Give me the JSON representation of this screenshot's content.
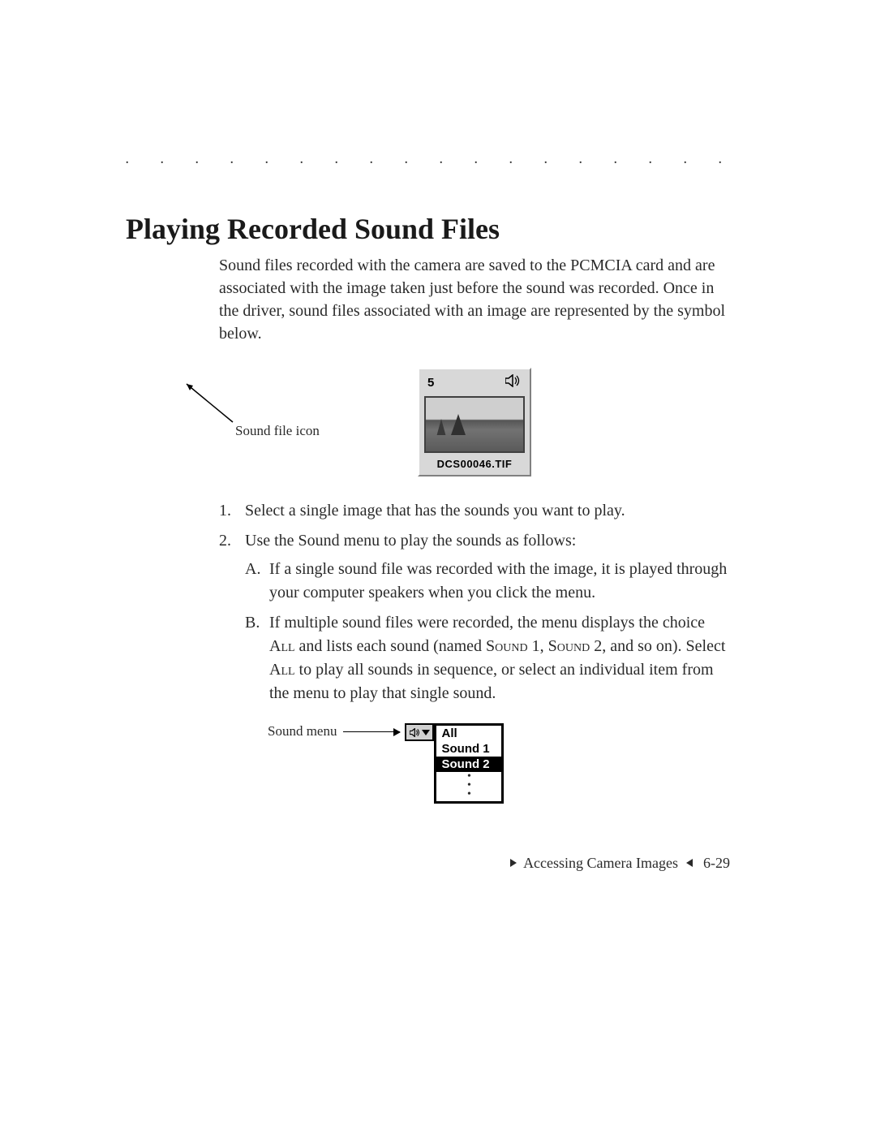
{
  "heading": "Playing Recorded Sound Files",
  "intro": "Sound files recorded with the camera are saved to the PCMCIA card and are associated with the image taken just before the sound was recorded. Once in the driver, sound files associated with an image are represented by the symbol below.",
  "thumbnail": {
    "number": "5",
    "filename": "DCS00046.TIF"
  },
  "labels": {
    "sound_file_icon": "Sound file icon",
    "sound_menu": "Sound menu"
  },
  "steps": {
    "1": "Select a single image that has the sounds you want to play.",
    "2": "Use the Sound menu to play the sounds as follows:",
    "2A": "If a single sound file was recorded with the image, it is played through your computer speakers when you click the menu.",
    "2B_pre": "If multiple sound files were recorded, the menu displays the choice ",
    "2B_all1": "All",
    "2B_mid1": " and lists each sound (named ",
    "2B_s1": "Sound",
    "2B_mid2": " 1, ",
    "2B_s2": "Sound",
    "2B_mid3": " 2, and so on). Select ",
    "2B_all2": "All",
    "2B_post": " to play all sounds in sequence, or select an individual item from the menu to play that single sound."
  },
  "menu": {
    "items": [
      "All",
      "Sound 1",
      "Sound 2"
    ],
    "selected_index": 2
  },
  "footer": {
    "section": "Accessing Camera Images",
    "page": "6-29"
  }
}
